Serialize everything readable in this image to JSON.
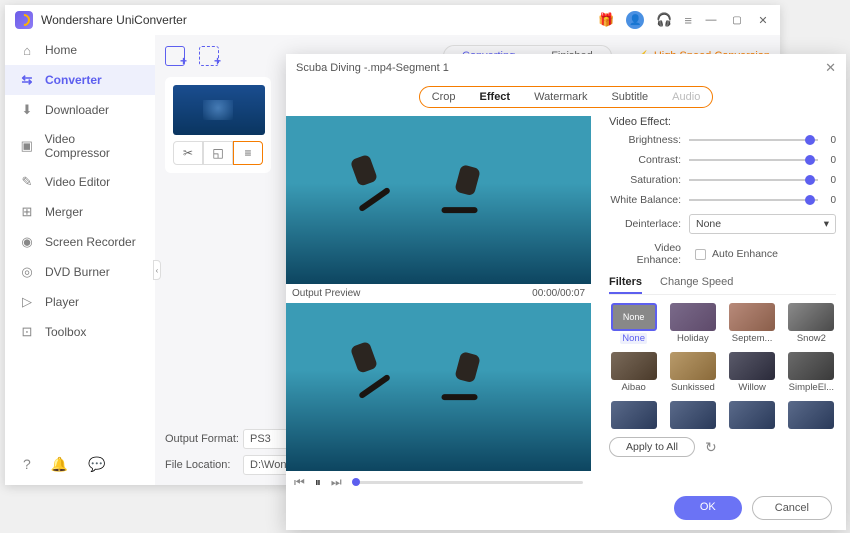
{
  "app": {
    "title": "Wondershare UniConverter"
  },
  "sidebar": {
    "items": [
      {
        "label": "Home",
        "icon": "⌂"
      },
      {
        "label": "Converter",
        "icon": "⇆"
      },
      {
        "label": "Downloader",
        "icon": "⬇"
      },
      {
        "label": "Video Compressor",
        "icon": "▣"
      },
      {
        "label": "Video Editor",
        "icon": "✎"
      },
      {
        "label": "Merger",
        "icon": "⊞"
      },
      {
        "label": "Screen Recorder",
        "icon": "◉"
      },
      {
        "label": "DVD Burner",
        "icon": "◎"
      },
      {
        "label": "Player",
        "icon": "▷"
      },
      {
        "label": "Toolbox",
        "icon": "⊡"
      }
    ]
  },
  "main": {
    "tabs": {
      "a": "Converting",
      "b": "Finished"
    },
    "highSpeed": "High Speed Conversion",
    "outputFormatLabel": "Output Format:",
    "outputFormatValue": "PS3",
    "fileLocationLabel": "File Location:",
    "fileLocationValue": "D:\\Wonders"
  },
  "editor": {
    "title": "Scuba Diving -.mp4-Segment 1",
    "tabs": {
      "crop": "Crop",
      "effect": "Effect",
      "watermark": "Watermark",
      "subtitle": "Subtitle",
      "audio": "Audio"
    },
    "previewLabel": "Output Preview",
    "time": "00:00/00:07",
    "sectionTitle": "Video Effect:",
    "sliders": {
      "brightness": {
        "label": "Brightness:",
        "value": "0"
      },
      "contrast": {
        "label": "Contrast:",
        "value": "0"
      },
      "saturation": {
        "label": "Saturation:",
        "value": "0"
      },
      "whiteBalance": {
        "label": "White Balance:",
        "value": "0"
      }
    },
    "deinterlaceLabel": "Deinterlace:",
    "deinterlaceValue": "None",
    "enhanceLabel": "Video Enhance:",
    "autoEnhance": "Auto Enhance",
    "subtabs": {
      "filters": "Filters",
      "changeSpeed": "Change Speed"
    },
    "filters": [
      {
        "label": "None",
        "cls": "none"
      },
      {
        "label": "Holiday",
        "cls": "holiday"
      },
      {
        "label": "Septem...",
        "cls": "sept"
      },
      {
        "label": "Snow2",
        "cls": "snow"
      },
      {
        "label": "Aibao",
        "cls": "aibao"
      },
      {
        "label": "Sunkissed",
        "cls": "sun"
      },
      {
        "label": "Willow",
        "cls": "willow"
      },
      {
        "label": "SimpleEl...",
        "cls": "simple"
      }
    ],
    "noneThumbText": "None",
    "applyAll": "Apply to All",
    "ok": "OK",
    "cancel": "Cancel"
  }
}
